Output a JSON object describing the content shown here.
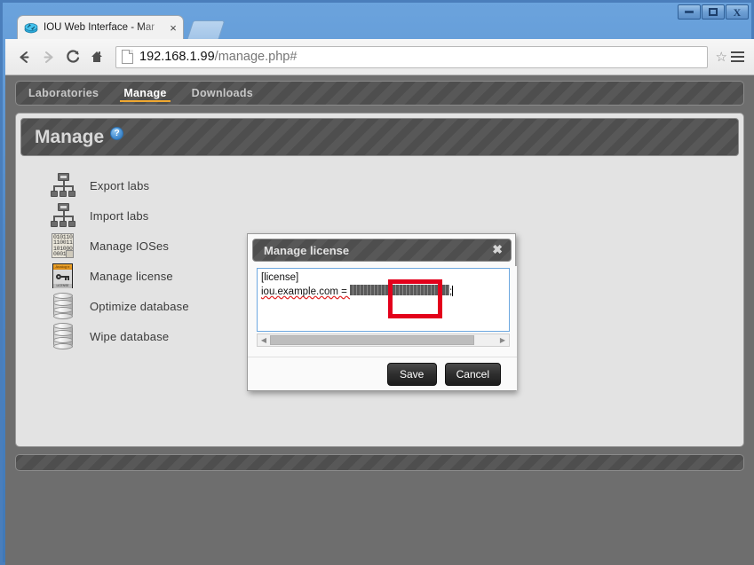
{
  "window": {
    "minimize_label": "Minimize",
    "restore_label": "Restore",
    "close_label": "Close"
  },
  "browser": {
    "tab": {
      "title": "IOU Web Interface - Mar",
      "favicon": "router-icon",
      "close_label": "×"
    },
    "new_tab_label": "",
    "back_label": "←",
    "forward_label": "→",
    "reload_label": "C",
    "home_label": "⌂",
    "url_host": "192.168.1.99",
    "url_path": "/manage.php#",
    "url_full": "192.168.1.99/manage.php#",
    "star_label": "☆",
    "menu_label": "menu-icon"
  },
  "page": {
    "nav": [
      {
        "label": "Laboratories",
        "active": false
      },
      {
        "label": "Manage",
        "active": true
      },
      {
        "label": "Downloads",
        "active": false
      }
    ],
    "panel_title": "Manage",
    "help_glyph": "?",
    "menu_items": [
      {
        "label": "Export labs",
        "icon": "org-chart-icon"
      },
      {
        "label": "Import labs",
        "icon": "org-chart-icon"
      },
      {
        "label": "Manage IOSes",
        "icon": "binary-document-icon"
      },
      {
        "label": "Manage license",
        "icon": "license-card-icon"
      },
      {
        "label": "Optimize database",
        "icon": "database-icon"
      },
      {
        "label": "Wipe database",
        "icon": "database-icon"
      }
    ],
    "binary_icon_lines": "010110\n110011\n101000\n0001",
    "license_icon_strip": "Analog·e",
    "license_icon_foot": "LICENSE"
  },
  "modal": {
    "title": "Manage license",
    "close_label": "✖",
    "textarea_line1": "[license]",
    "textarea_line2_prefix": "iou.example.com = ",
    "textarea_line2_suffix": ";",
    "textarea_redacted": "redacted-license-key",
    "scroll_left_label": "◀",
    "scroll_right_label": "▶",
    "save_label": "Save",
    "cancel_label": "Cancel"
  },
  "annotation": {
    "highlight_target": "save-button",
    "highlight_color": "#e3001b"
  }
}
